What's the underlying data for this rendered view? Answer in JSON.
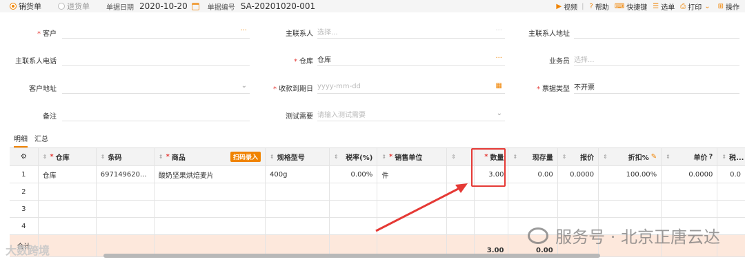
{
  "top": {
    "sale_label": "销货单",
    "return_label": "退货单",
    "date_label": "单据日期",
    "date_value": "2020-10-20",
    "no_label": "单据编号",
    "no_value": "SA-20201020-001"
  },
  "toolbar": {
    "video": "视频",
    "help": "帮助",
    "shortcut": "快捷键",
    "select": "选单",
    "print": "打印",
    "ops": "操作"
  },
  "form": {
    "customer_label": "客户",
    "contact_label": "主联系人",
    "contact_placeholder": "选择...",
    "contact_addr_label": "主联系人地址",
    "contact_phone_label": "主联系人电话",
    "warehouse_label": "仓库",
    "warehouse_value": "仓库",
    "salesman_label": "业务员",
    "salesman_placeholder": "选择...",
    "cust_addr_label": "客户地址",
    "due_label": "收款到期日",
    "due_placeholder": "yyyy-mm-dd",
    "invoice_label": "票据类型",
    "invoice_value": "不开票",
    "note_label": "备注",
    "test_label": "测试需要",
    "test_placeholder": "请输入测试需要"
  },
  "tabs": {
    "detail": "明细",
    "summary": "汇总"
  },
  "grid": {
    "headers": {
      "warehouse": "仓库",
      "barcode": "条码",
      "product": "商品",
      "scan": "扫码录入",
      "spec": "规格型号",
      "tax": "税率(%)",
      "unit": "销售单位",
      "qty": "数量",
      "stock": "现存量",
      "quote": "报价",
      "discount": "折扣%",
      "price": "单价",
      "tax2": "税..."
    },
    "rows": [
      {
        "no": "1",
        "warehouse": "仓库",
        "barcode": "697149620...",
        "product": "酸奶坚果烘焙麦片",
        "spec": "400g",
        "tax": "0.00%",
        "unit": "件",
        "qty": "3.00",
        "stock": "0.00",
        "quote": "0.0000",
        "discount": "100.00%",
        "price": "0.0000",
        "tax2": "0.0"
      },
      {
        "no": "2"
      },
      {
        "no": "3"
      },
      {
        "no": "4"
      }
    ],
    "total_label": "合计",
    "total_qty": "3.00",
    "total_stock": "0.00"
  },
  "watermark": {
    "text": "服务号 · 北京正唐云达",
    "corner": "大数跨境"
  },
  "colors": {
    "accent": "#f08300",
    "highlight": "#e53935"
  }
}
